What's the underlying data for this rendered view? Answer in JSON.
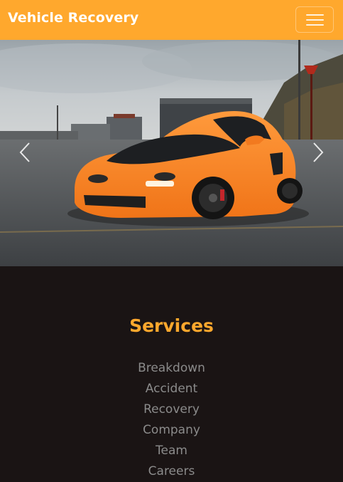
{
  "navbar": {
    "brand": "Vehicle Recovery",
    "toggler_icon": "hamburger-menu-icon",
    "background_color": "#ffa82d"
  },
  "carousel": {
    "image": "orange sports car parked on road",
    "prev_icon": "chevron-left-icon",
    "next_icon": "chevron-right-icon"
  },
  "services": {
    "title": "Services",
    "title_color": "#ffa82d",
    "items": [
      {
        "label": "Breakdown"
      },
      {
        "label": "Accident"
      },
      {
        "label": "Recovery"
      },
      {
        "label": "Company"
      },
      {
        "label": "Team"
      },
      {
        "label": "Careers"
      }
    ]
  }
}
